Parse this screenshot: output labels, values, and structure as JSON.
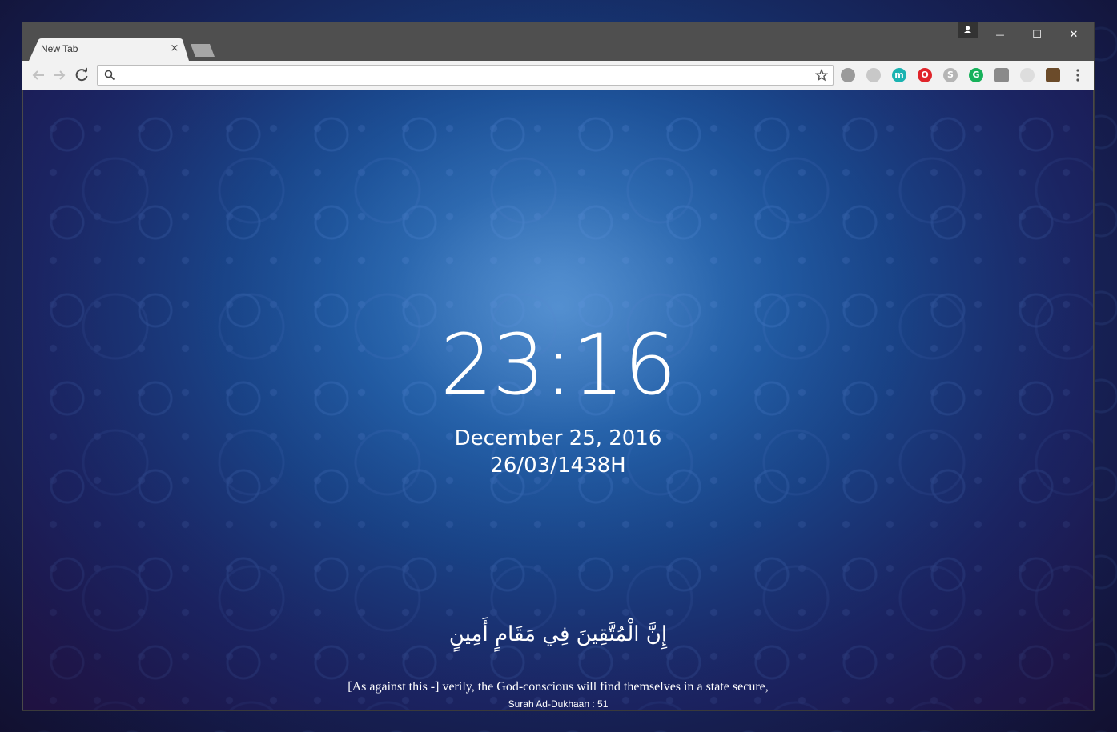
{
  "browser": {
    "tab_title": "New Tab",
    "tab_close_glyph": "×",
    "omnibox_value": "",
    "window_controls": {
      "minimize": "—",
      "maximize": "☐",
      "close": "✕"
    },
    "extensions": [
      {
        "name": "extension-gray-icon",
        "color": "#9a9a9a"
      },
      {
        "name": "extension-light-gray-icon",
        "color": "#c8c8c8"
      },
      {
        "name": "extension-m-icon",
        "color": "#1ab3b1",
        "glyph": "m"
      },
      {
        "name": "extension-opera-icon",
        "color": "#e0252b",
        "glyph": "O"
      },
      {
        "name": "extension-skype-icon",
        "color": "#b5b5b5",
        "glyph": "S"
      },
      {
        "name": "extension-grammarly-icon",
        "color": "#16b15a",
        "glyph": "G"
      },
      {
        "name": "extension-square-icon",
        "color": "#8a8a8a"
      },
      {
        "name": "extension-faded-icon",
        "color": "#dddddd"
      },
      {
        "name": "extension-image-icon",
        "color": "#6b4b2a"
      }
    ]
  },
  "page": {
    "time": "23:16",
    "date": "December 25, 2016",
    "hijri_date": "26/03/1438H",
    "verse_arabic": "إِنَّ الْمُتَّقِينَ فِي مَقَامٍ أَمِينٍ",
    "verse_translation": "[As against this -] verily, the God-conscious will find themselves in a state secure,",
    "verse_reference": "Surah Ad-Dukhaan : 51"
  },
  "colors": {
    "titlebar": "#4f4f4f",
    "toolbar": "#f2f2f2",
    "text_white": "#ffffff",
    "wallpaper_center": "#4a86c8",
    "wallpaper_edge": "#211d55"
  }
}
